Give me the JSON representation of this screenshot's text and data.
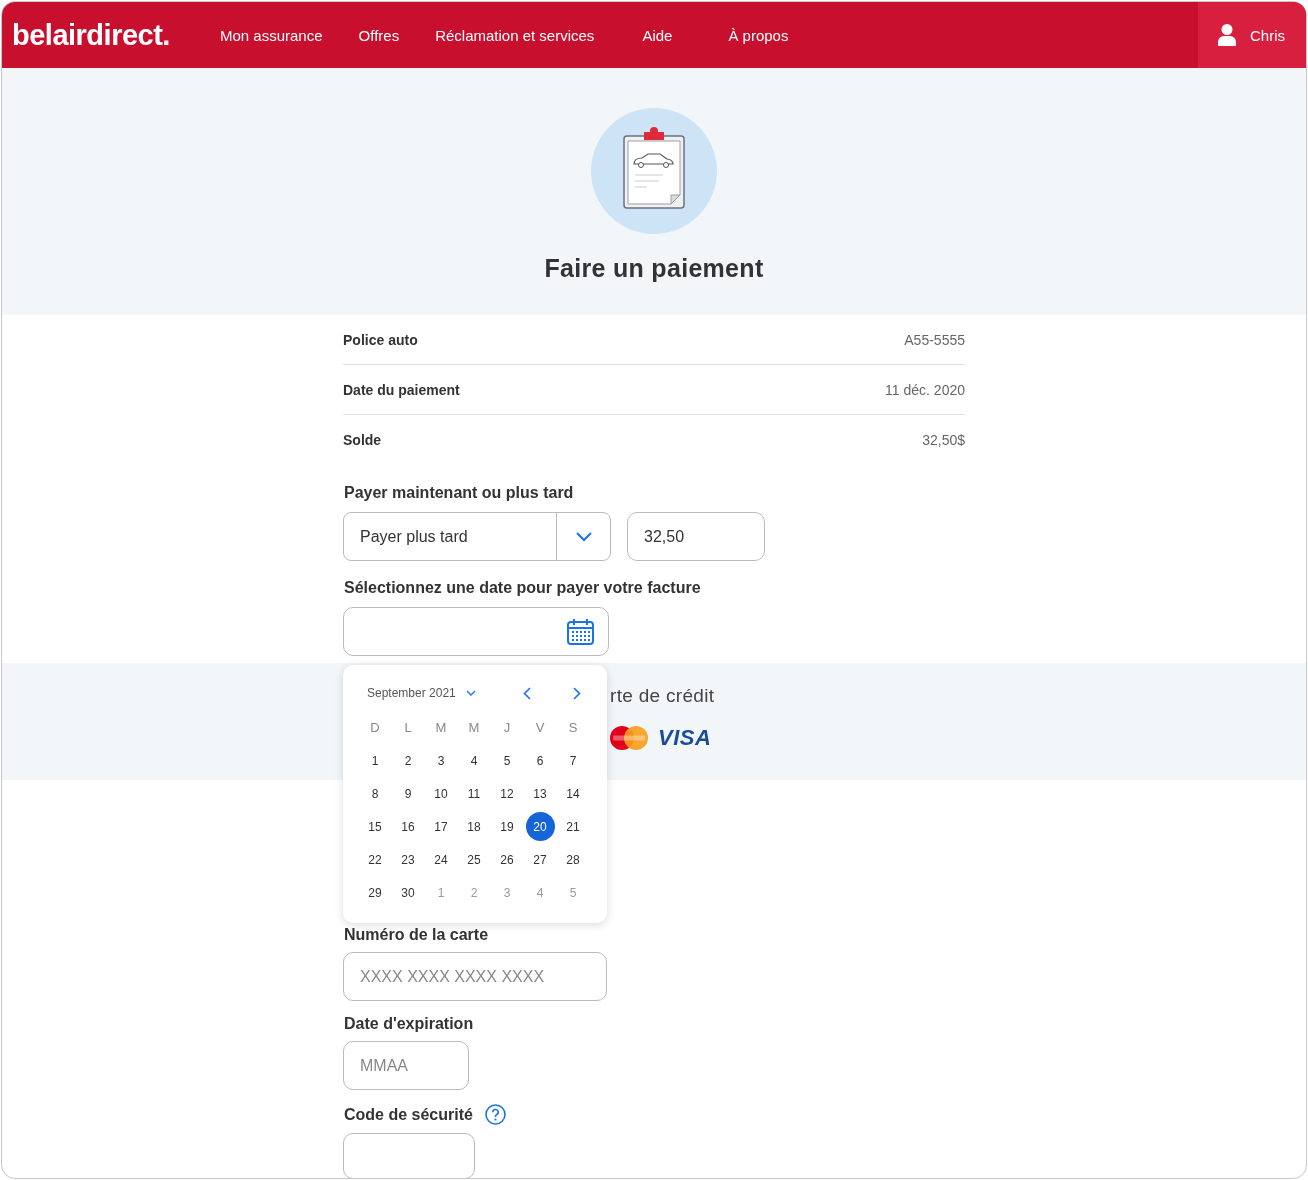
{
  "header": {
    "logo": "belairdirect.",
    "nav": [
      {
        "label": "Mon assurance"
      },
      {
        "label": "Offres"
      },
      {
        "label": "Réclamation et services"
      },
      {
        "label": "Aide"
      },
      {
        "label": "À propos"
      }
    ],
    "user": "Chris"
  },
  "title": "Faire un paiement",
  "details": [
    {
      "label": "Police auto",
      "value": "A55-5555"
    },
    {
      "label": "Date du paiement",
      "value": "11 déc. 2020"
    },
    {
      "label": "Solde",
      "value": "32,50$"
    }
  ],
  "pay_when": {
    "label": "Payer maintenant ou plus tard",
    "value": "Payer plus tard",
    "amount": "32,50"
  },
  "date_field": {
    "label": "Sélectionnez une date pour payer votre facture"
  },
  "calendar": {
    "month": "September 2021",
    "weekdays": [
      "D",
      "L",
      "M",
      "M",
      "J",
      "V",
      "S"
    ],
    "days": [
      {
        "day": "1",
        "kind": "current",
        "selected": false
      },
      {
        "day": "2",
        "kind": "current",
        "selected": false
      },
      {
        "day": "3",
        "kind": "current",
        "selected": false
      },
      {
        "day": "4",
        "kind": "current",
        "selected": false
      },
      {
        "day": "5",
        "kind": "current",
        "selected": false
      },
      {
        "day": "6",
        "kind": "current",
        "selected": false
      },
      {
        "day": "7",
        "kind": "current",
        "selected": false
      },
      {
        "day": "8",
        "kind": "current",
        "selected": false
      },
      {
        "day": "9",
        "kind": "current",
        "selected": false
      },
      {
        "day": "10",
        "kind": "current",
        "selected": false
      },
      {
        "day": "11",
        "kind": "current",
        "selected": false
      },
      {
        "day": "12",
        "kind": "current",
        "selected": false
      },
      {
        "day": "13",
        "kind": "current",
        "selected": false
      },
      {
        "day": "14",
        "kind": "current",
        "selected": false
      },
      {
        "day": "15",
        "kind": "current",
        "selected": false
      },
      {
        "day": "16",
        "kind": "current",
        "selected": false
      },
      {
        "day": "17",
        "kind": "current",
        "selected": false
      },
      {
        "day": "18",
        "kind": "current",
        "selected": false
      },
      {
        "day": "19",
        "kind": "current",
        "selected": false
      },
      {
        "day": "20",
        "kind": "current",
        "selected": true
      },
      {
        "day": "21",
        "kind": "current",
        "selected": false
      },
      {
        "day": "22",
        "kind": "current",
        "selected": false
      },
      {
        "day": "23",
        "kind": "current",
        "selected": false
      },
      {
        "day": "24",
        "kind": "current",
        "selected": false
      },
      {
        "day": "25",
        "kind": "current",
        "selected": false
      },
      {
        "day": "26",
        "kind": "current",
        "selected": false
      },
      {
        "day": "27",
        "kind": "current",
        "selected": false
      },
      {
        "day": "28",
        "kind": "current",
        "selected": false
      },
      {
        "day": "29",
        "kind": "current",
        "selected": false
      },
      {
        "day": "30",
        "kind": "current",
        "selected": false
      },
      {
        "day": "1",
        "kind": "other",
        "selected": false
      },
      {
        "day": "2",
        "kind": "other",
        "selected": false
      },
      {
        "day": "3",
        "kind": "other",
        "selected": false
      },
      {
        "day": "4",
        "kind": "other",
        "selected": false
      },
      {
        "day": "5",
        "kind": "other",
        "selected": false
      }
    ]
  },
  "card_section": {
    "heading": "rte de crédit",
    "brands": [
      "VISA"
    ]
  },
  "card_number": {
    "label": "Numéro de la carte",
    "placeholder": "XXXX XXXX XXXX XXXX"
  },
  "expiry": {
    "label": "Date d'expiration",
    "placeholder": "MMAA"
  },
  "security": {
    "label": "Code de sécurité"
  }
}
